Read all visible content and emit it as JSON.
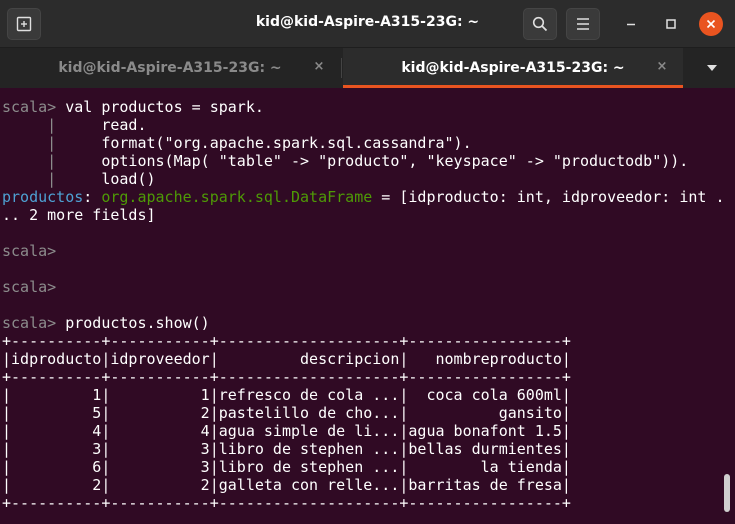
{
  "window": {
    "title": "kid@kid-Aspire-A315-23G: ~"
  },
  "tabs": [
    {
      "label": "kid@kid-Aspire-A315-23G: ~",
      "close": "×"
    },
    {
      "label": "kid@kid-Aspire-A315-23G: ~",
      "close": "×"
    }
  ],
  "terminal": {
    "prompt": "scala>",
    "cont": "     |",
    "lines": {
      "l1_cmd": " val productos = spark.",
      "l2": "     read.",
      "l3": "     format(\"org.apache.spark.sql.cassandra\").",
      "l4": "     options(Map( \"table\" -> \"producto\", \"keyspace\" -> \"productodb\")).",
      "l5": "     load()",
      "res_name": "productos",
      "res_colon": ": ",
      "res_type": "org.apache.spark.sql.DataFrame",
      "res_rest": " = [idproducto: int, idproveedor: int .",
      "res_wrap": ".. 2 more fields]",
      "show_cmd": " productos.show()"
    },
    "table": [
      "+----------+-----------+--------------------+-----------------+",
      "|idproducto|idproveedor|         descripcion|   nombreproducto|",
      "+----------+-----------+--------------------+-----------------+",
      "|         1|          1|refresco de cola ...|  coca cola 600ml|",
      "|         5|          2|pastelillo de cho...|          gansito|",
      "|         4|          4|agua simple de li...|agua bonafont 1.5|",
      "|         3|          3|libro de stephen ...|bellas durmientes|",
      "|         6|          3|libro de stephen ...|        la tienda|",
      "|         2|          2|galleta con relle...|barritas de fresa|",
      "+----------+-----------+--------------------+-----------------+"
    ]
  },
  "colors": {
    "terminal_bg": "#300a24",
    "accent": "#e95420",
    "type_green": "#4e9a06",
    "name_blue": "#4ea1d3"
  },
  "icons": {
    "new_tab": "new-tab-icon",
    "search": "search-icon",
    "menu": "hamburger-menu-icon",
    "minimize": "minimize-icon",
    "maximize": "maximize-icon",
    "close": "close-icon",
    "dropdown": "chevron-down-icon"
  }
}
